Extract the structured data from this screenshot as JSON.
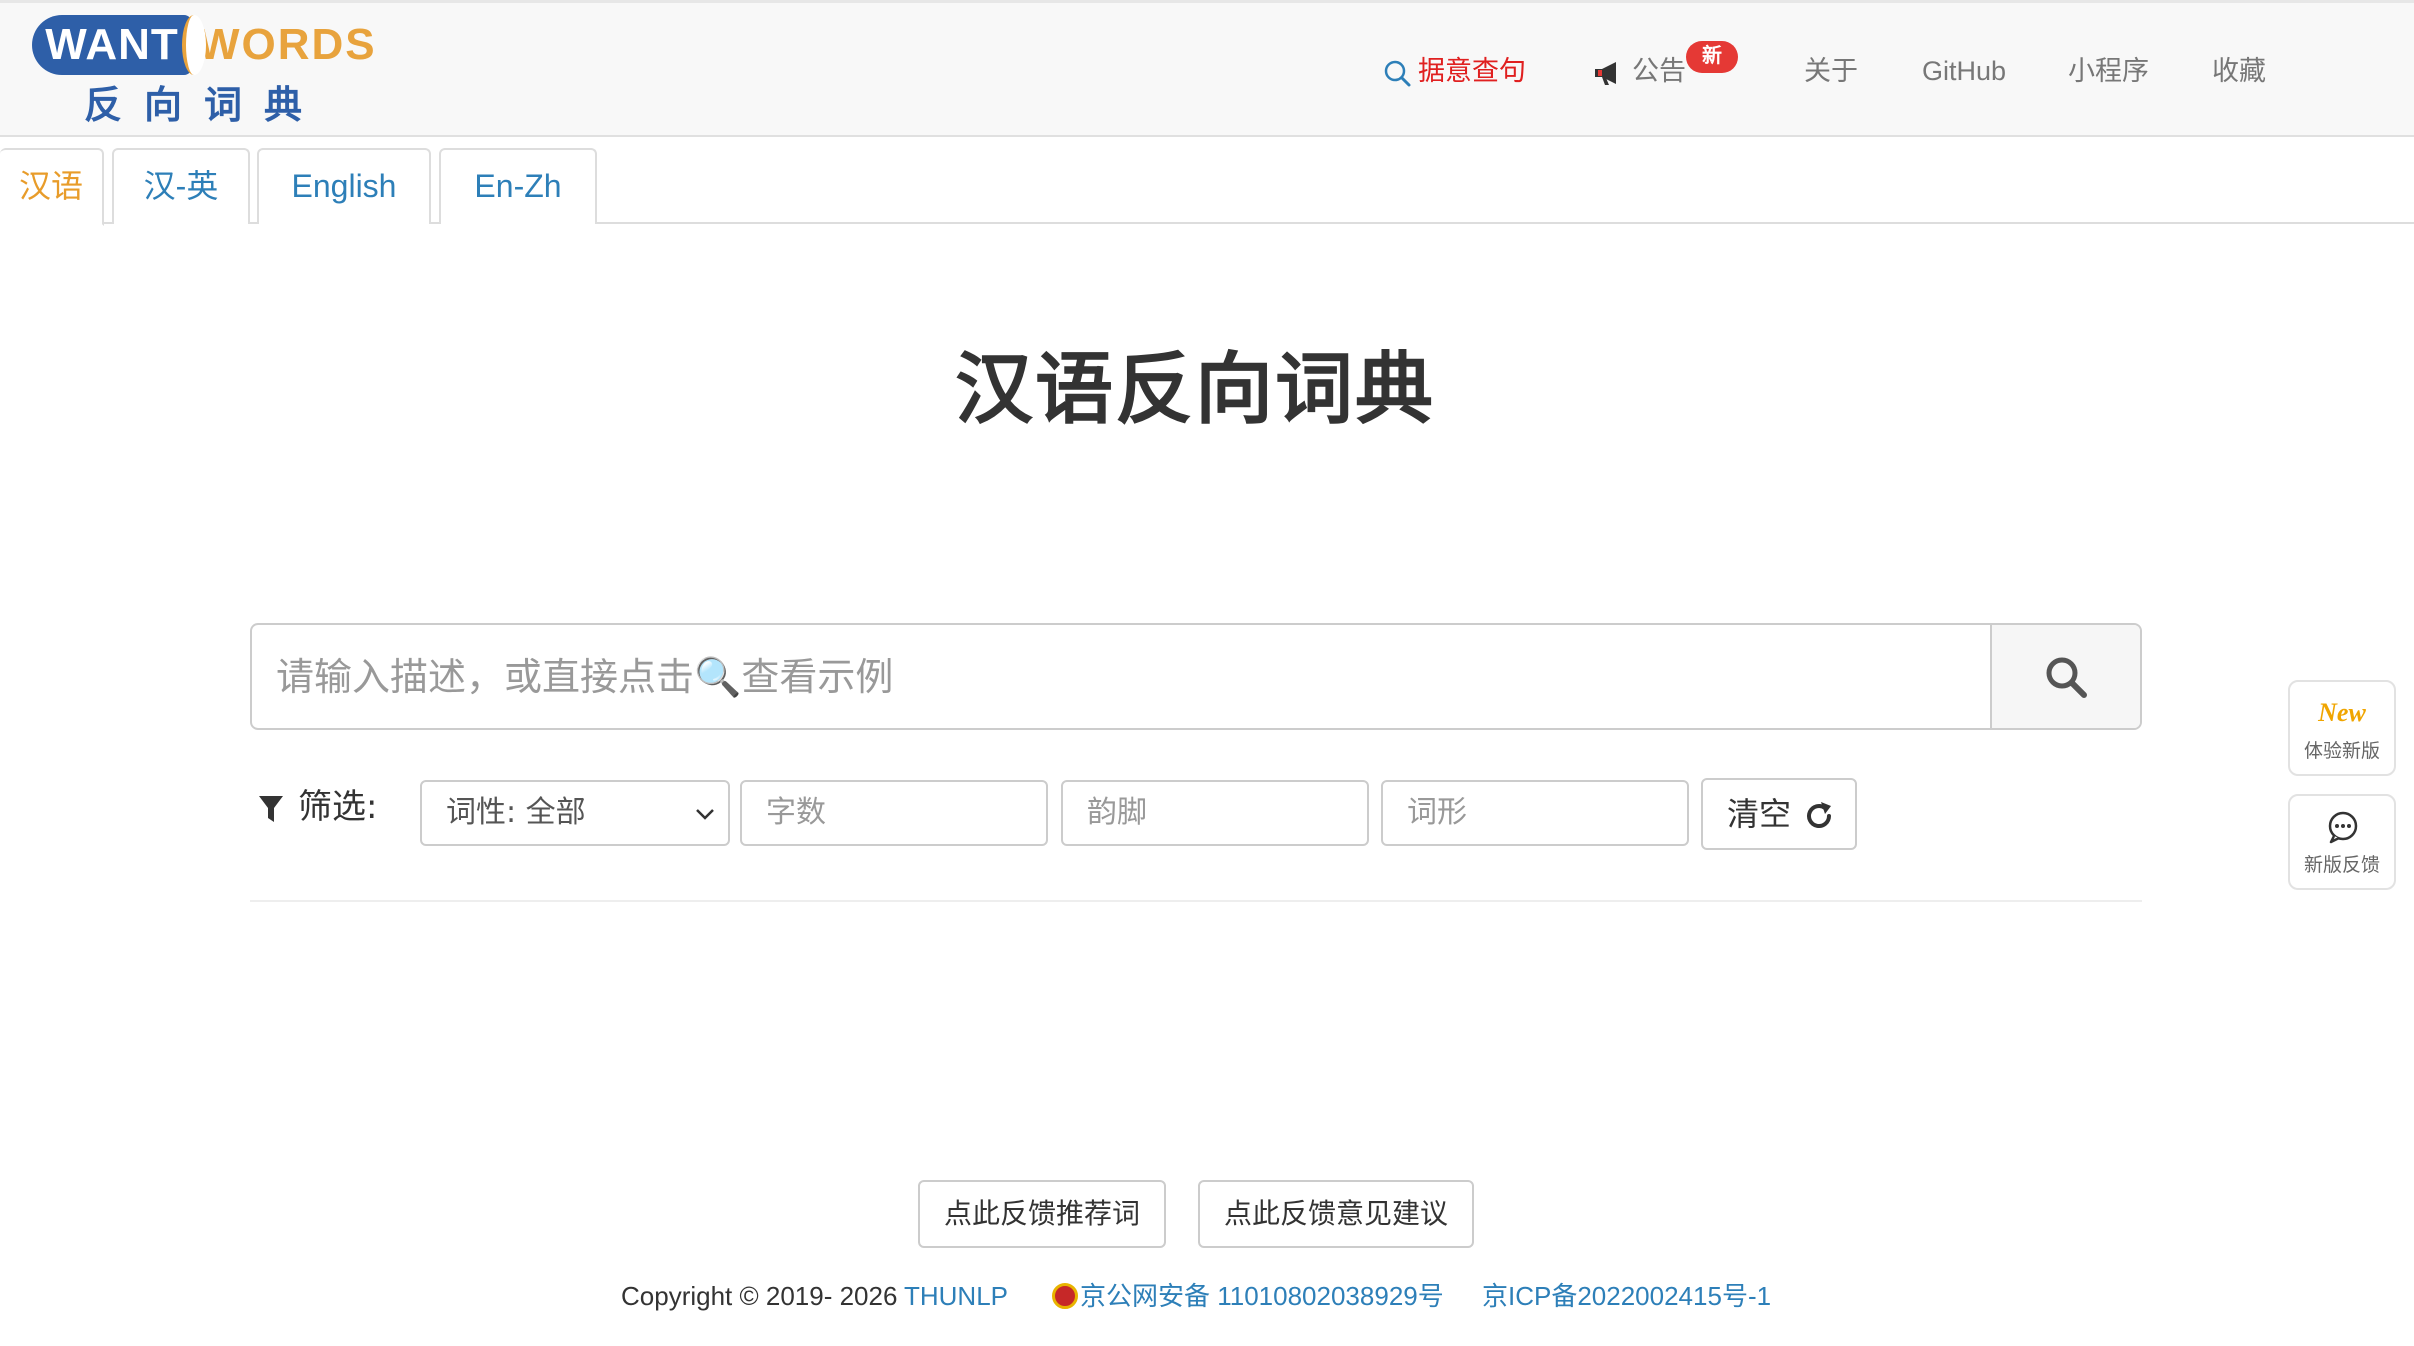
{
  "logo": {
    "want": "WANT",
    "words": "WORDS",
    "cn": "反向词典"
  },
  "nav": {
    "search": "据意查句",
    "notice": "公告",
    "notice_badge": "新",
    "about": "关于",
    "github": "GitHub",
    "mini": "小程序",
    "fav": "收藏"
  },
  "tabs": [
    {
      "label": "汉语",
      "active": true
    },
    {
      "label": "汉-英",
      "active": false
    },
    {
      "label": "English",
      "active": false
    },
    {
      "label": "En-Zh",
      "active": false
    }
  ],
  "main": {
    "title": "汉语反向词典",
    "search_placeholder": "请输入描述，或直接点击🔍查看示例"
  },
  "filter": {
    "label": "筛选:",
    "pos_select": "词性: 全部",
    "char_count_placeholder": "字数",
    "rhyme_placeholder": "韵脚",
    "form_placeholder": "词形",
    "clear_label": "清空"
  },
  "side": {
    "new_mark": "New",
    "new_label": "体验新版",
    "feedback_label": "新版反馈"
  },
  "footer": {
    "feedback_rec": "点此反馈推荐词",
    "feedback_sug": "点此反馈意见建议",
    "copyright": "Copyright © 2019- 2026",
    "org": "THUNLP",
    "police": "京公网安备 11010802038929号",
    "icp": "京ICP备2022002415号-1"
  },
  "colors": {
    "brand_blue": "#2e5fa8",
    "brand_orange": "#e8a33d",
    "link": "#2d7fb8",
    "badge_red": "#e53935",
    "active_tab": "#e89c2a"
  }
}
